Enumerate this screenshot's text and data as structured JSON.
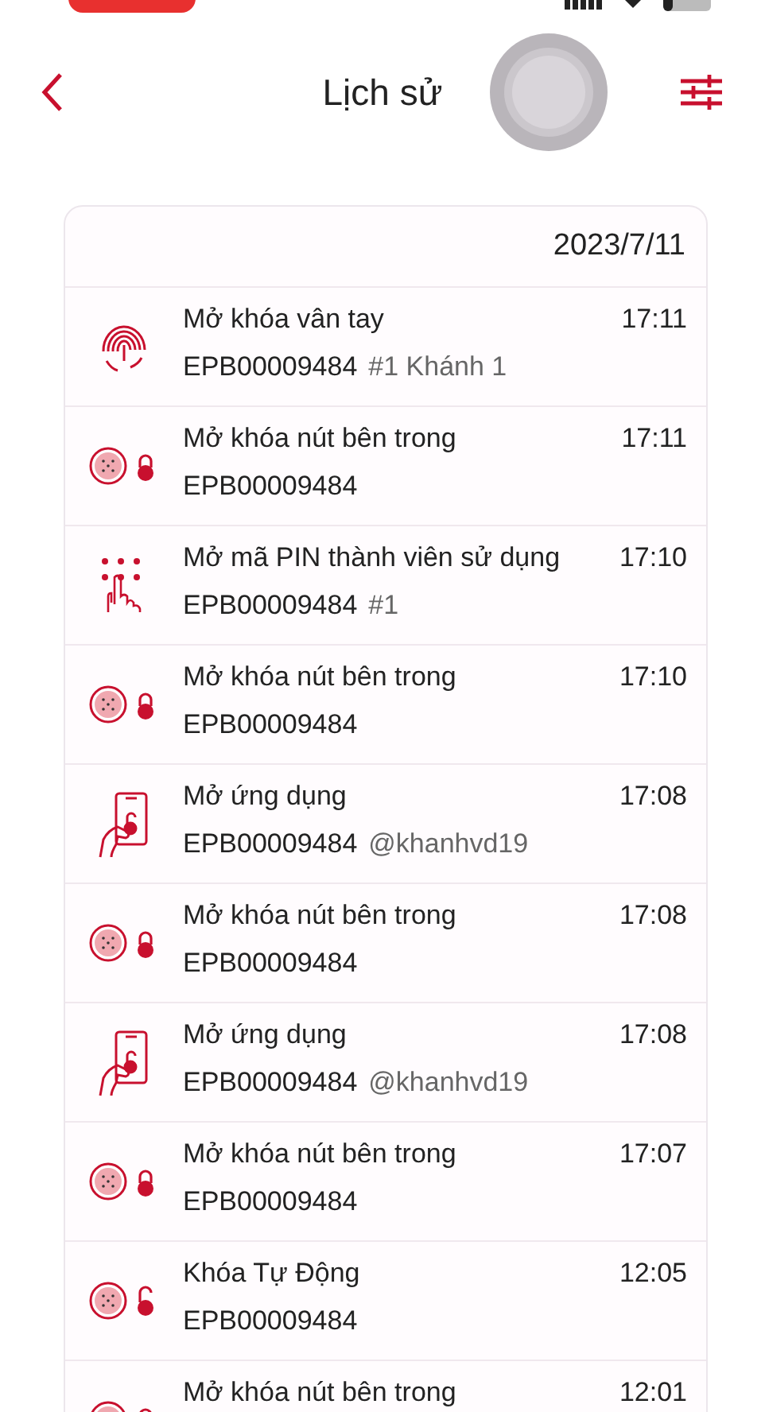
{
  "header": {
    "title": "Lịch sử"
  },
  "history": {
    "date": "2023/7/11",
    "entries": [
      {
        "kind": "fingerprint",
        "title": "Mở khóa vân tay",
        "time": "17:11",
        "device": "EPB00009484",
        "detail": "#1 Khánh 1"
      },
      {
        "kind": "button_locked",
        "title": "Mở khóa nút bên trong",
        "time": "17:11",
        "device": "EPB00009484"
      },
      {
        "kind": "pin",
        "title": "Mở mã PIN thành viên sử dụng",
        "time": "17:10",
        "device": "EPB00009484",
        "detail": "#1"
      },
      {
        "kind": "button_locked",
        "title": "Mở khóa nút bên trong",
        "time": "17:10",
        "device": "EPB00009484"
      },
      {
        "kind": "app",
        "title": "Mở ứng dụng",
        "time": "17:08",
        "device": "EPB00009484",
        "detail": "@khanhvd19"
      },
      {
        "kind": "button_locked",
        "title": "Mở khóa nút bên trong",
        "time": "17:08",
        "device": "EPB00009484"
      },
      {
        "kind": "app",
        "title": "Mở ứng dụng",
        "time": "17:08",
        "device": "EPB00009484",
        "detail": "@khanhvd19"
      },
      {
        "kind": "button_locked",
        "title": "Mở khóa nút bên trong",
        "time": "17:07",
        "device": "EPB00009484"
      },
      {
        "kind": "button_unlocked",
        "title": "Khóa Tự Động",
        "time": "12:05",
        "device": "EPB00009484"
      },
      {
        "kind": "button_locked",
        "title": "Mở khóa nút bên trong",
        "time": "12:01"
      }
    ]
  }
}
